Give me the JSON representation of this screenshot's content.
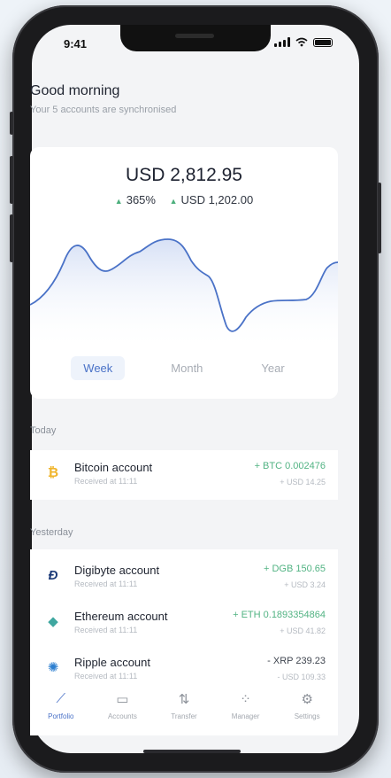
{
  "status": {
    "time": "9:41"
  },
  "greeting": {
    "title": "Good morning",
    "subtitle": "Your 5 accounts are synchronised"
  },
  "portfolio": {
    "total": "USD 2,812.95",
    "change_pct": "365%",
    "change_value": "USD 1,202.00",
    "ranges": [
      "Week",
      "Month",
      "Year"
    ],
    "active_range": "Week",
    "accent": "#4a72c7",
    "positive_color": "#4caf7d"
  },
  "sections": {
    "today": "Today",
    "yesterday": "Yesterday"
  },
  "transactions": {
    "bitcoin": {
      "name": "Bitcoin account",
      "sub": "Received at 11:11",
      "amount": "+ BTC 0.002476",
      "fiat": "+ USD 14.25",
      "icon": "bitcoin-icon"
    },
    "digibyte": {
      "name": "Digibyte account",
      "sub": "Received at 11:11",
      "amount": "+ DGB 150.65",
      "fiat": "+ USD 3.24",
      "icon": "digibyte-icon"
    },
    "ethereum": {
      "name": "Ethereum account",
      "sub": "Received at 11:11",
      "amount": "+ ETH 0.1893354864",
      "fiat": "+ USD 41.82",
      "icon": "ethereum-icon"
    },
    "ripple": {
      "name": "Ripple account",
      "sub": "Received at 11:11",
      "amount": "- XRP 239.23",
      "fiat": "- USD 109.33",
      "icon": "ripple-icon"
    }
  },
  "tabbar": {
    "portfolio": "Portfolio",
    "accounts": "Accounts",
    "transfer": "Transfer",
    "manager": "Manager",
    "settings": "Settings"
  }
}
